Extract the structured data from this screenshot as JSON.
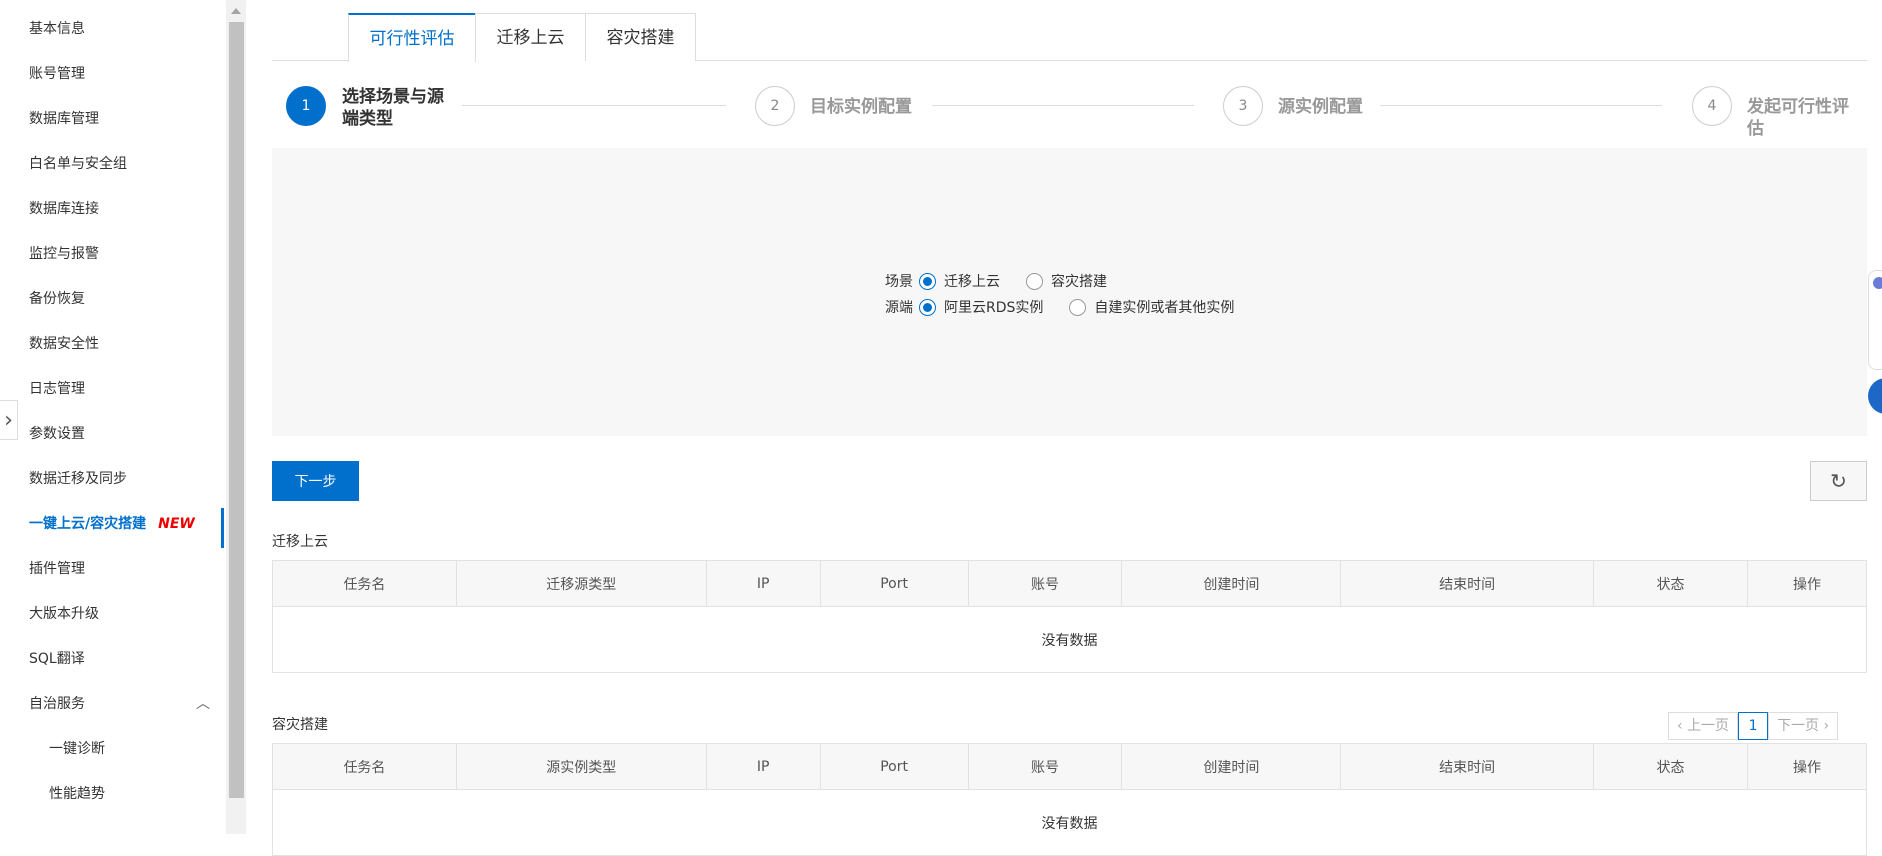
{
  "sidebar": {
    "items": [
      {
        "label": "基本信息"
      },
      {
        "label": "账号管理"
      },
      {
        "label": "数据库管理"
      },
      {
        "label": "白名单与安全组"
      },
      {
        "label": "数据库连接"
      },
      {
        "label": "监控与报警"
      },
      {
        "label": "备份恢复"
      },
      {
        "label": "数据安全性"
      },
      {
        "label": "日志管理"
      },
      {
        "label": "参数设置"
      },
      {
        "label": "数据迁移及同步"
      },
      {
        "label": "一键上云/容灾搭建",
        "badge": "NEW",
        "active": true
      },
      {
        "label": "插件管理"
      },
      {
        "label": "大版本升级"
      },
      {
        "label": "SQL翻译"
      },
      {
        "label": "自治服务",
        "expanded": true
      },
      {
        "label": "一键诊断",
        "sub": true
      },
      {
        "label": "性能趋势",
        "sub": true
      }
    ]
  },
  "tabs": [
    {
      "label": "可行性评估",
      "active": true
    },
    {
      "label": "迁移上云"
    },
    {
      "label": "容灾搭建"
    }
  ],
  "steps": [
    {
      "num": "1",
      "label_line1": "选择场景与源",
      "label_line2": "端类型",
      "active": true
    },
    {
      "num": "2",
      "label_line1": "目标实例配置",
      "label_line2": ""
    },
    {
      "num": "3",
      "label_line1": "源实例配置",
      "label_line2": ""
    },
    {
      "num": "4",
      "label_line1": "发起可行性评",
      "label_line2": "估"
    }
  ],
  "form": {
    "scene_label": "场景",
    "scene_options": [
      "迁移上云",
      "容灾搭建"
    ],
    "scene_selected": "迁移上云",
    "source_label": "源端",
    "source_options": [
      "阿里云RDS实例",
      "自建实例或者其他实例"
    ],
    "source_selected": "阿里云RDS实例"
  },
  "actions": {
    "next_label": "下一步",
    "refresh_icon": "refresh-icon"
  },
  "migration_table": {
    "title": "迁移上云",
    "columns": [
      "任务名",
      "迁移源类型",
      "IP",
      "Port",
      "账号",
      "创建时间",
      "结束时间",
      "状态",
      "操作"
    ],
    "empty_text": "没有数据"
  },
  "dr_table": {
    "title": "容灾搭建",
    "columns": [
      "任务名",
      "源实例类型",
      "IP",
      "Port",
      "账号",
      "创建时间",
      "结束时间",
      "状态",
      "操作"
    ],
    "empty_text": "没有数据"
  },
  "pager": {
    "prev_label": "上一页",
    "current": "1",
    "next_label": "下一页"
  },
  "colors": {
    "accent": "#0070cc",
    "new_badge": "#e00000",
    "panel_bg": "#f7f7f7"
  }
}
